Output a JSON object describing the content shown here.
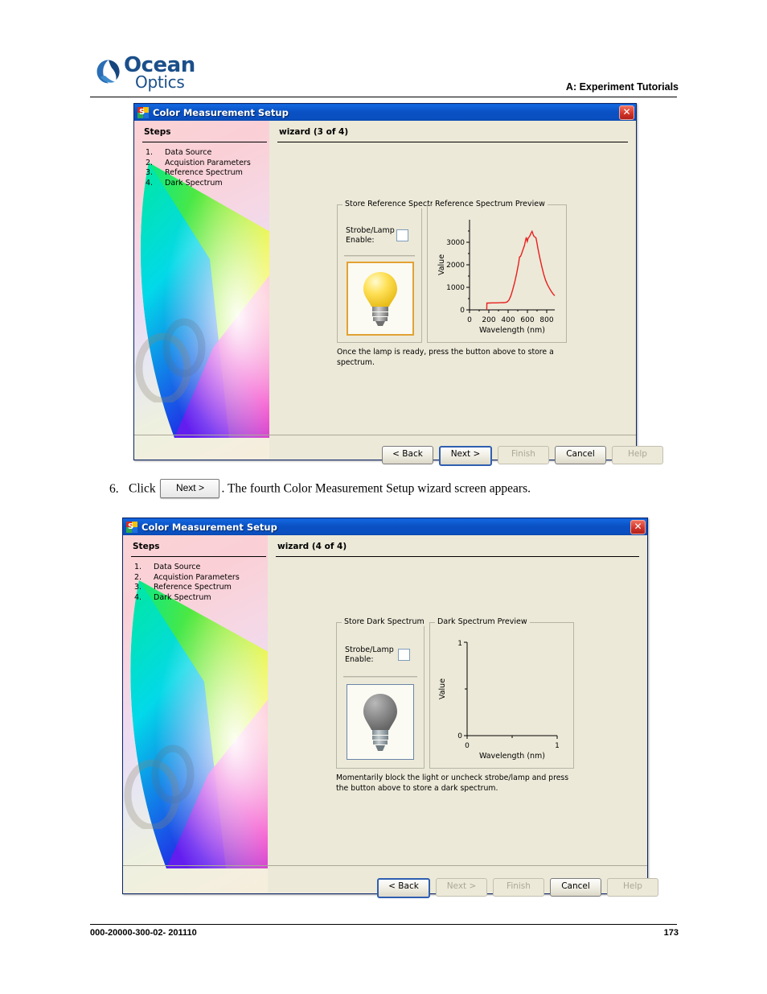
{
  "header": {
    "logo_line1": "Ocean",
    "logo_line2": "Optics",
    "section_title": "A: Experiment Tutorials"
  },
  "footer": {
    "doc_number": "000-20000-300-02- 201110",
    "page_number": "173"
  },
  "step_instruction": {
    "number": "6.",
    "before": "Click",
    "button_label": "Next >",
    "after": ". The fourth Color Measurement Setup wizard screen appears."
  },
  "dialog1": {
    "title": "Color Measurement Setup",
    "close_label": "✕",
    "steps_heading": "Steps",
    "steps": [
      {
        "num": "1.",
        "label": "Data Source"
      },
      {
        "num": "2.",
        "label": "Acquistion Parameters"
      },
      {
        "num": "3.",
        "label": "Reference Spectrum"
      },
      {
        "num": "4.",
        "label": "Dark Spectrum"
      }
    ],
    "wizard_label": "wizard (3 of 4)",
    "store_group_label": "Store Reference Spectr",
    "strobe_label": "Strobe/Lamp\nEnable:",
    "strobe_checked": false,
    "bulb_icon": "lightbulb-on-icon",
    "help_text": "Once the lamp is ready, press the button above to store a spectrum.",
    "preview_group_label": "Reference Spectrum Preview",
    "buttons": [
      {
        "name": "back",
        "label": "< Back",
        "state": "enabled",
        "underline": "B"
      },
      {
        "name": "next",
        "label": "Next >",
        "state": "default",
        "underline": ""
      },
      {
        "name": "finish",
        "label": "Finish",
        "state": "disabled",
        "underline": "F"
      },
      {
        "name": "cancel",
        "label": "Cancel",
        "state": "enabled",
        "underline": ""
      },
      {
        "name": "help",
        "label": "Help",
        "state": "disabled",
        "underline": "H"
      }
    ]
  },
  "dialog2": {
    "title": "Color Measurement Setup",
    "close_label": "✕",
    "steps_heading": "Steps",
    "steps": [
      {
        "num": "1.",
        "label": "Data Source"
      },
      {
        "num": "2.",
        "label": "Acquistion Parameters"
      },
      {
        "num": "3.",
        "label": "Reference Spectrum"
      },
      {
        "num": "4.",
        "label": "Dark Spectrum"
      }
    ],
    "wizard_label": "wizard (4 of 4)",
    "store_group_label": "Store Dark Spectrum",
    "strobe_label": "Strobe/Lamp\nEnable:",
    "strobe_checked": false,
    "bulb_icon": "lightbulb-off-icon",
    "help_text": "Momentarily block the light or uncheck strobe/lamp and press the button above to store a dark spectrum.",
    "preview_group_label": "Dark Spectrum Preview",
    "buttons": [
      {
        "name": "back",
        "label": "< Back",
        "state": "default",
        "underline": "B"
      },
      {
        "name": "next",
        "label": "Next >",
        "state": "disabled",
        "underline": ""
      },
      {
        "name": "finish",
        "label": "Finish",
        "state": "disabled",
        "underline": "F"
      },
      {
        "name": "cancel",
        "label": "Cancel",
        "state": "enabled",
        "underline": ""
      },
      {
        "name": "help",
        "label": "Help",
        "state": "disabled",
        "underline": "H"
      }
    ]
  },
  "chart_data": [
    {
      "id": "reference-spectrum-preview",
      "type": "line",
      "title": "Reference Spectrum Preview",
      "xlabel": "Wavelength (nm)",
      "ylabel": "Value",
      "xlim": [
        0,
        880
      ],
      "ylim": [
        0,
        3500
      ],
      "xticks": [
        0,
        200,
        400,
        600,
        800
      ],
      "yticks": [
        0,
        1000,
        2000,
        3000
      ],
      "grid": false,
      "legend": "none",
      "line_color": "#e81f1f",
      "series": [
        {
          "name": "reference spectrum",
          "x": [
            178,
            180,
            200,
            240,
            280,
            320,
            360,
            390,
            410,
            430,
            450,
            470,
            490,
            500,
            510,
            520,
            530,
            545,
            560,
            570,
            580,
            590,
            600,
            610,
            620,
            630,
            640,
            650,
            660,
            670,
            680,
            690,
            700,
            720,
            740,
            760,
            780,
            800,
            820,
            840,
            860,
            875
          ],
          "y": [
            0,
            300,
            305,
            310,
            312,
            315,
            320,
            345,
            430,
            620,
            900,
            1250,
            1700,
            1980,
            2000,
            2100,
            2300,
            2520,
            2700,
            2900,
            3080,
            2900,
            3050,
            3100,
            3180,
            3280,
            3350,
            3220,
            3120,
            3100,
            3060,
            2850,
            2600,
            2180,
            1800,
            1450,
            1180,
            980,
            820,
            680,
            560,
            500
          ]
        }
      ]
    },
    {
      "id": "dark-spectrum-preview",
      "type": "line",
      "title": "Dark Spectrum Preview",
      "xlabel": "Wavelength (nm)",
      "ylabel": "Value",
      "xlim": [
        0,
        1
      ],
      "ylim": [
        0,
        1
      ],
      "xticks": [
        0,
        1
      ],
      "yticks": [
        0,
        1
      ],
      "grid": false,
      "legend": "none",
      "line_color": "#e81f1f",
      "series": [
        {
          "name": "dark spectrum",
          "x": [],
          "y": []
        }
      ]
    }
  ]
}
